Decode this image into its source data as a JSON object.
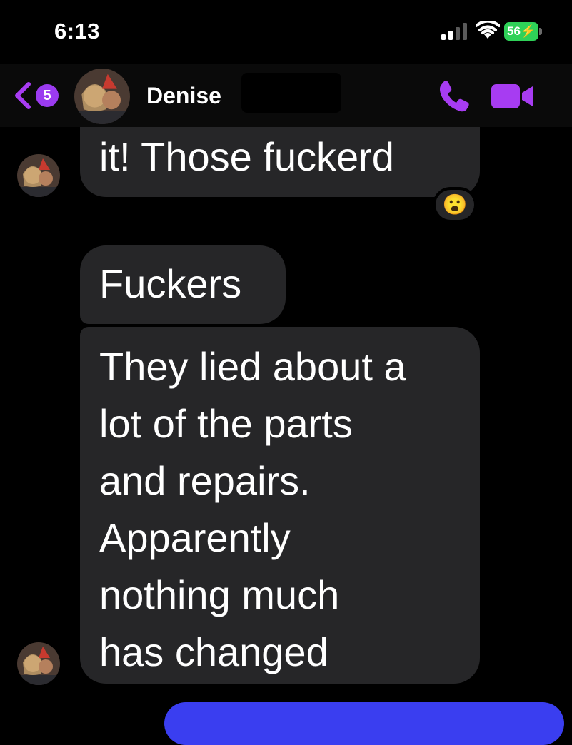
{
  "status_bar": {
    "time": "6:13",
    "battery_level": "56",
    "battery_color": "#2fd158",
    "icons": [
      "signal-icon",
      "wifi-icon",
      "battery-icon",
      "charging-icon"
    ]
  },
  "header": {
    "back_badge_count": "5",
    "contact_name": "Denise",
    "accent_color": "#a73cf2",
    "icons": [
      "chevron-left-icon",
      "phone-icon",
      "video-camera-icon"
    ]
  },
  "messages": [
    {
      "sender": "Denise",
      "text": "it! Those fuckerd",
      "reaction": "😮"
    },
    {
      "sender": "Denise",
      "text": "Fuckers"
    },
    {
      "sender": "Denise",
      "lines": [
        "They lied about a",
        "lot of the parts",
        "and repairs.",
        "Apparently",
        "nothing much",
        "has changed"
      ]
    }
  ],
  "colors": {
    "incoming_bubble": "#262628",
    "outgoing_bubble": "#3a3ef0",
    "background": "#000000"
  }
}
